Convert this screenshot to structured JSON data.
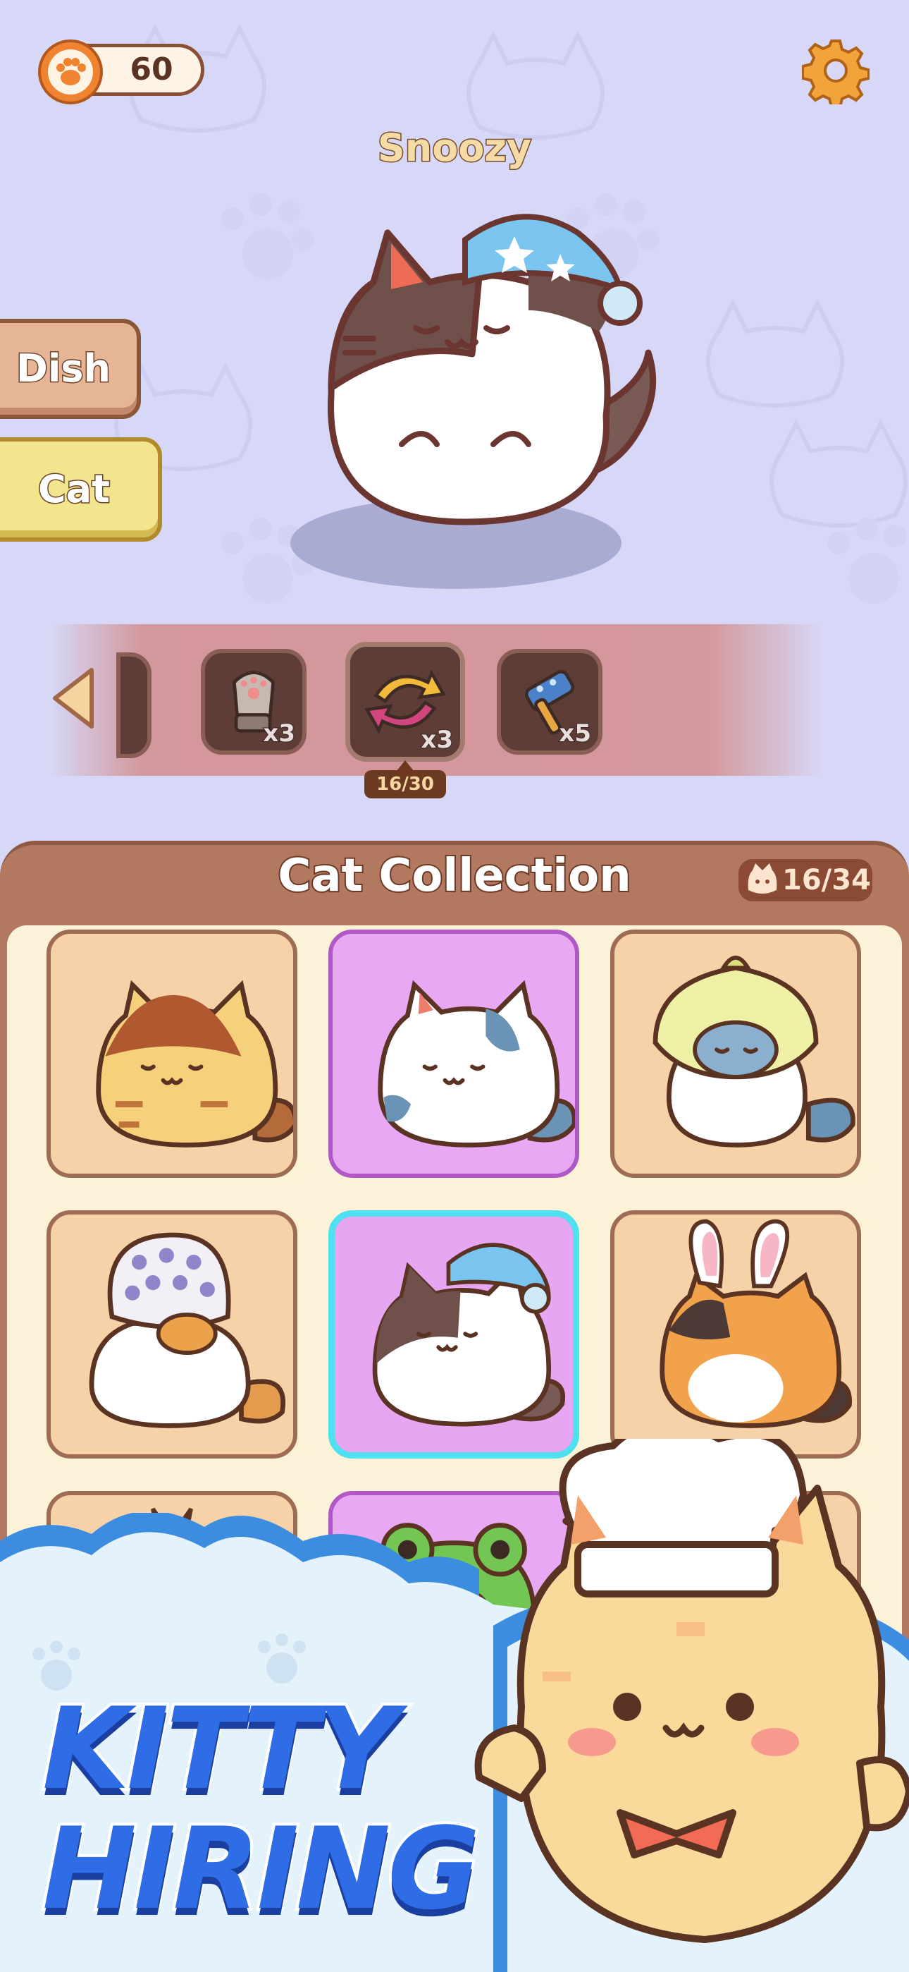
{
  "hud": {
    "coins": "60",
    "coin_icon": "paw-coin-icon",
    "settings_icon": "gear-icon"
  },
  "cat": {
    "name": "Snoozy"
  },
  "side_tabs": {
    "dish": "Dish",
    "cat": "Cat"
  },
  "items": [
    {
      "name": "paw-glove",
      "count": "x3"
    },
    {
      "name": "swap",
      "count": "x3"
    },
    {
      "name": "hammer",
      "count": "x5"
    }
  ],
  "progress": "16/30",
  "collection": {
    "title": "Cat Collection",
    "count": "16/34"
  },
  "banner": {
    "line1": "KITTY",
    "line2": "HIRING"
  },
  "colors": {
    "background": "#d7d8f7",
    "panel": "#b27860",
    "selected": "#4fe0f2",
    "unlocked": "#e8a8f3"
  }
}
